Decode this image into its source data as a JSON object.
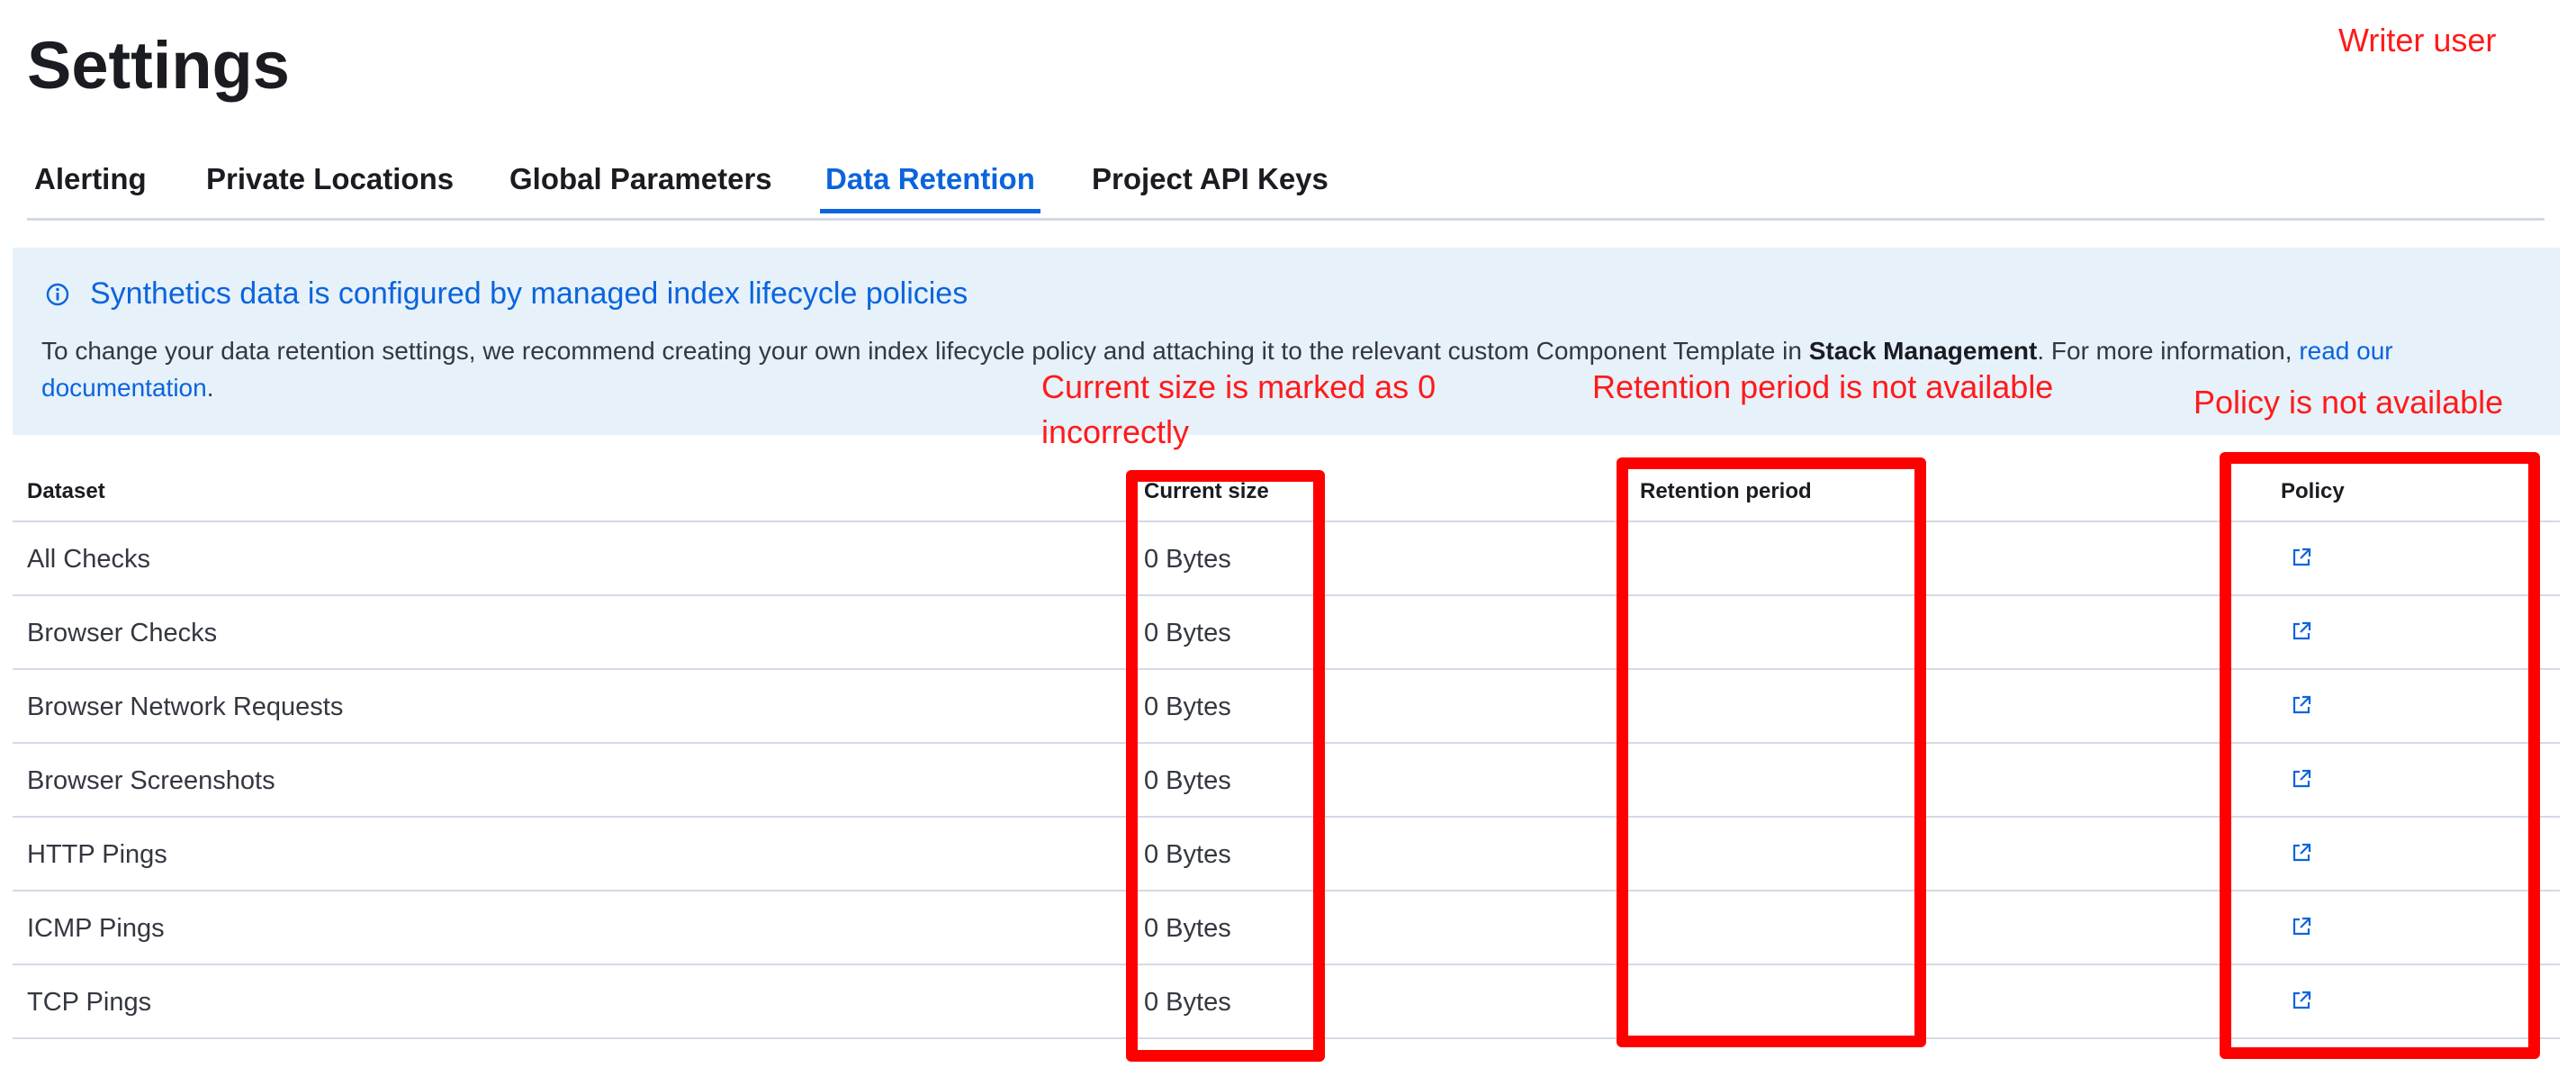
{
  "page_title": "Settings",
  "tabs": [
    {
      "label": "Alerting",
      "active": false
    },
    {
      "label": "Private Locations",
      "active": false
    },
    {
      "label": "Global Parameters",
      "active": false
    },
    {
      "label": "Data Retention",
      "active": true
    },
    {
      "label": "Project API Keys",
      "active": false
    }
  ],
  "callout": {
    "icon": "info-icon",
    "title": "Synthetics data is configured by managed index lifecycle policies",
    "body_prefix": "To change your data retention settings, we recommend creating your own index lifecycle policy and attaching it to the relevant custom Component Template in ",
    "body_bold": "Stack Management",
    "body_middle": ". For more information, ",
    "link_text": "read our documentation",
    "body_suffix": "."
  },
  "table": {
    "headers": {
      "dataset": "Dataset",
      "current_size": "Current size",
      "retention_period": "Retention period",
      "policy": "Policy"
    },
    "rows": [
      {
        "dataset": "All Checks",
        "current_size": "0 Bytes",
        "retention_period": "",
        "policy_icon": "external-link-icon"
      },
      {
        "dataset": "Browser Checks",
        "current_size": "0 Bytes",
        "retention_period": "",
        "policy_icon": "external-link-icon"
      },
      {
        "dataset": "Browser Network Requests",
        "current_size": "0 Bytes",
        "retention_period": "",
        "policy_icon": "external-link-icon"
      },
      {
        "dataset": "Browser Screenshots",
        "current_size": "0 Bytes",
        "retention_period": "",
        "policy_icon": "external-link-icon"
      },
      {
        "dataset": "HTTP Pings",
        "current_size": "0 Bytes",
        "retention_period": "",
        "policy_icon": "external-link-icon"
      },
      {
        "dataset": "ICMP Pings",
        "current_size": "0 Bytes",
        "retention_period": "",
        "policy_icon": "external-link-icon"
      },
      {
        "dataset": "TCP Pings",
        "current_size": "0 Bytes",
        "retention_period": "",
        "policy_icon": "external-link-icon"
      }
    ]
  },
  "annotations": {
    "writer_user": "Writer user",
    "current_size_line1": "Current size is marked as 0",
    "current_size_line2": "incorrectly",
    "retention_period": "Retention period is not available",
    "policy": "Policy is not available"
  },
  "colors": {
    "accent": "#0b64dd",
    "callout_bg": "#e6f1fa",
    "annotation_red": "#ff0000",
    "border": "#d3dae6"
  }
}
